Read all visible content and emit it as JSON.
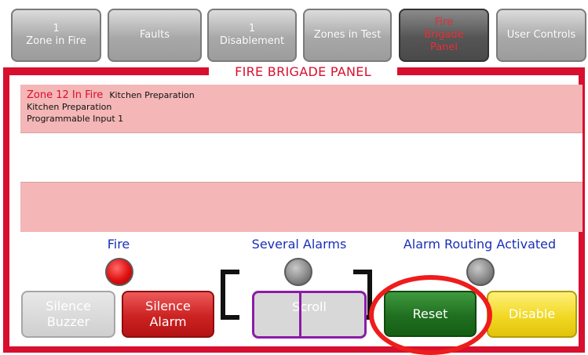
{
  "tabs": [
    {
      "line1": "1",
      "line2": "Zone in Fire",
      "line3": ""
    },
    {
      "line1": "Faults",
      "line2": "",
      "line3": ""
    },
    {
      "line1": "1",
      "line2": "Disablement",
      "line3": ""
    },
    {
      "line1": "Zones in Test",
      "line2": "",
      "line3": ""
    },
    {
      "line1": "Fire",
      "line2": "Brigade",
      "line3": "Panel"
    },
    {
      "line1": "User Controls",
      "line2": "",
      "line3": ""
    }
  ],
  "active_tab_color": "#e8323a",
  "panel_title": "FIRE BRIGADE PANEL",
  "alarms": [
    {
      "zone": "Zone 12 In Fire",
      "zone_name": "Kitchen Preparation",
      "detail1": "Kitchen Preparation",
      "detail2": "Programmable Input 1"
    }
  ],
  "indicators": {
    "fire": {
      "label": "Fire",
      "state": "red"
    },
    "several_alarms": {
      "label": "Several Alarms",
      "state": "grey"
    },
    "alarm_routing": {
      "label": "Alarm Routing Activated",
      "state": "grey"
    }
  },
  "buttons": {
    "silence_buzzer": {
      "line1": "Silence",
      "line2": "Buzzer"
    },
    "silence_alarm": {
      "line1": "Silence",
      "line2": "Alarm"
    },
    "scroll": "Scroll",
    "reset": "Reset",
    "disable": "Disable"
  },
  "colors": {
    "frame_red": "#d80f2e",
    "label_blue": "#1a2fb8",
    "reset_green": "#206f20",
    "disable_yellow": "#f1d824",
    "scroll_purple": "#8a1ca8",
    "highlight_red": "#ee1c1c"
  }
}
